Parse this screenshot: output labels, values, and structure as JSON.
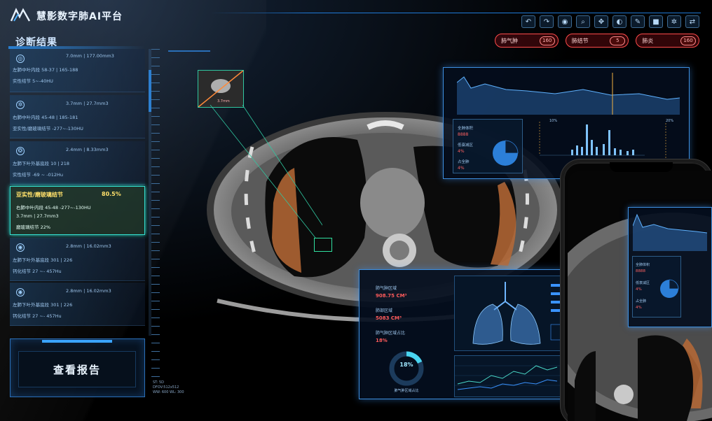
{
  "app": {
    "title": "慧影数字肺AI平台"
  },
  "toolbar": {
    "icons": [
      "undo-icon",
      "redo-icon",
      "eye-icon",
      "zoom-icon",
      "move-icon",
      "contrast-icon",
      "pen-icon",
      "square-icon",
      "settings-icon",
      "share-icon"
    ],
    "glyphs": [
      "↶",
      "↷",
      "◉",
      "⌕",
      "✥",
      "◐",
      "✎",
      "■",
      "✲",
      "⇄"
    ]
  },
  "tags": [
    {
      "label": "肺气肿",
      "badge": "160"
    },
    {
      "label": "肺结节",
      "badge": "5"
    },
    {
      "label": "肺炎",
      "badge": "160"
    }
  ],
  "results": {
    "title": "诊断结果",
    "items": [
      {
        "icon": "◎",
        "lines": [
          "7.0mm | 177.00mm3",
          "左肺中叶内段        58-37  |  165-188",
          "实性结节             5~-40HU"
        ]
      },
      {
        "icon": "✲",
        "lines": [
          "3.7mm | 27.7mm3",
          "右肺中叶内段        45-48  |  185-181",
          "亚实性/磨玻璃结节    -277~-130HU"
        ]
      },
      {
        "icon": "❂",
        "lines": [
          "2.4mm | 8.33mm3",
          "左肺下叶外基底段    10  |  218",
          "实性结节             -69 ~ -012Hu"
        ]
      },
      {
        "icon": "",
        "lines": [
          "亚实性/磨玻璃结节",
          "80.5%",
          "右肺中叶内段       45-48       -277~-130HU",
          "3.7mm | 27.7mm3",
          "磨玻璃结节    22%"
        ]
      },
      {
        "icon": "◉",
        "lines": [
          "2.8mm | 16.02mm3",
          "左肺下叶外基底段    301  |  226",
          "钙化结节             27 ~- 457Hu"
        ]
      },
      {
        "icon": "◉",
        "lines": [
          "2.8mm | 16.02mm3",
          "左肺下叶外基底段    301  |  226",
          "钙化结节             27 ~- 457Hu"
        ]
      }
    ]
  },
  "report_button": "查看报告",
  "scale_info": [
    "ST: 5D",
    "DFOV:512x512",
    "WW: 600  WL: 300"
  ],
  "scan": {
    "zoom_label": "3.7mm"
  },
  "chart_card": {
    "stats": [
      {
        "label": "全肺体积",
        "value": "8888"
      },
      {
        "label": "低衰减区",
        "value": "4%"
      },
      {
        "label": "占全肺",
        "value": "4%"
      }
    ],
    "axis_labels": [
      "10%",
      "20%"
    ]
  },
  "lung_card": {
    "rows": [
      {
        "label": "肺气肿区域",
        "value": "908.75 CM³"
      },
      {
        "label": "肺部区域",
        "value": "5083 CM³"
      },
      {
        "label": "肺气肿区域占比",
        "value": "18%"
      }
    ],
    "donut_pct": "18%",
    "donut_caption": "肺气肿区域占比"
  },
  "phone": {
    "stats": [
      {
        "label": "全肺体积",
        "value": "8888"
      },
      {
        "label": "低衰减区",
        "value": "4%"
      },
      {
        "label": "占全肺",
        "value": "4%"
      }
    ]
  }
}
